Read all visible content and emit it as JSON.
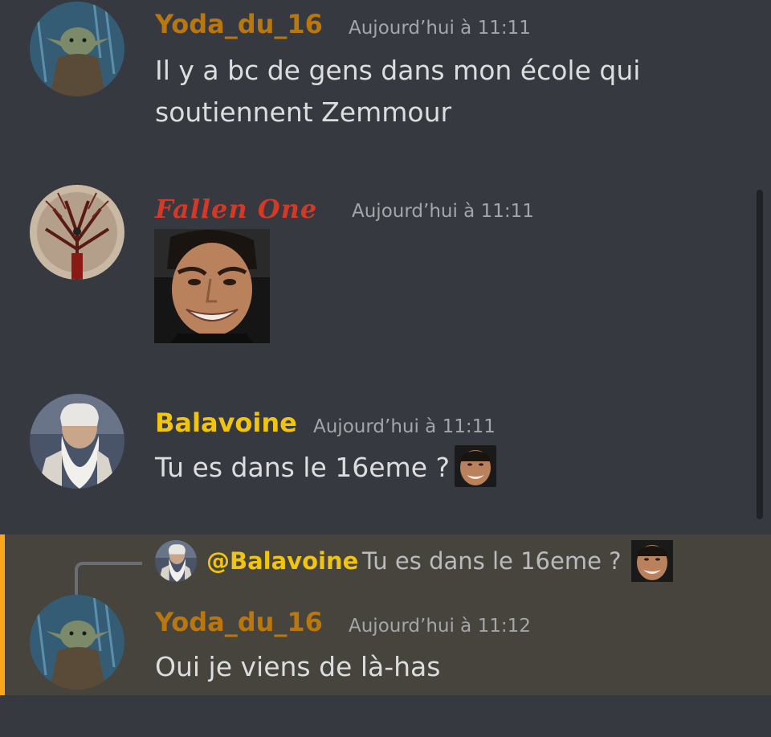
{
  "messages": [
    {
      "author": "Yoda_du_16",
      "timestamp": "Aujourd’hui à 11:11",
      "lines": [
        "Il y a bc de gens dans mon école qui",
        "soutiennent Zemmour"
      ]
    },
    {
      "author": "Fallen One",
      "timestamp": "Aujourd’hui à 11:11",
      "attachment": "smiling-man-image"
    },
    {
      "author": "Balavoine",
      "timestamp": "Aujourd’hui à 11:11",
      "text": "Tu es dans le 16eme ?",
      "emoji": "smiling-man-emoji"
    },
    {
      "author": "Yoda_du_16",
      "timestamp": "Aujourd’hui à 11:12",
      "text": "Oui je viens de là-has",
      "reply": {
        "mention": "@Balavoine",
        "text": "Tu es dans le 16eme ?",
        "emoji": "smiling-man-emoji"
      }
    }
  ],
  "colors": {
    "background": "#36393f",
    "yoda": "#b9770e",
    "balavoine": "#f1c40f",
    "fallen_one": "#d43826",
    "highlight": "#46443c",
    "highlight_bar": "#faa81a"
  }
}
